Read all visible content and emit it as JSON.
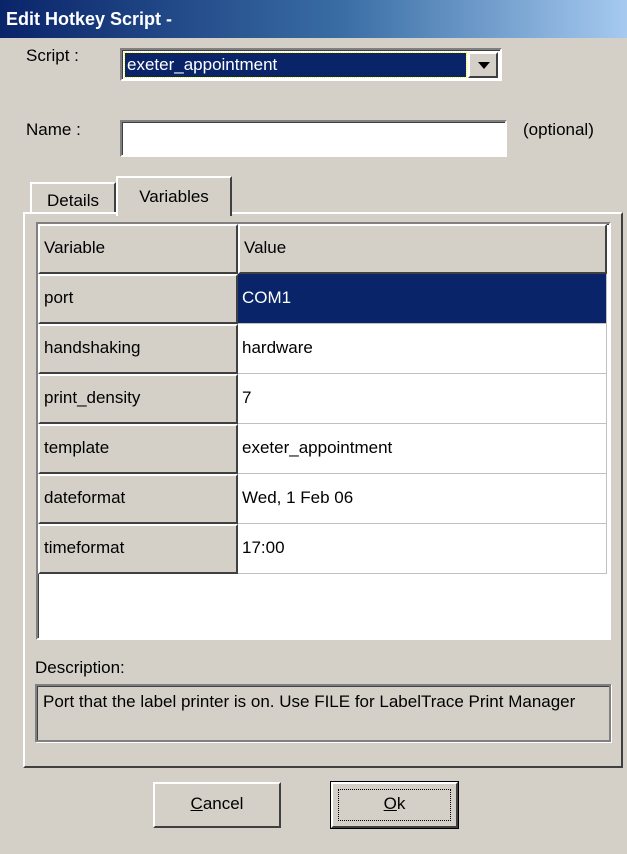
{
  "window": {
    "title": "Edit Hotkey Script -"
  },
  "form": {
    "script_label": "Script :",
    "script_value": "exeter_appointment",
    "name_label": "Name :",
    "name_value": "",
    "optional_label": "(optional)"
  },
  "tabs": [
    {
      "label": "Details",
      "active": false
    },
    {
      "label": "Variables",
      "active": true
    }
  ],
  "grid": {
    "headers": [
      "Variable",
      "Value"
    ],
    "rows": [
      {
        "name": "port",
        "value": "COM1",
        "selected": true
      },
      {
        "name": "handshaking",
        "value": "hardware"
      },
      {
        "name": "print_density",
        "value": "7"
      },
      {
        "name": "template",
        "value": "exeter_appointment"
      },
      {
        "name": "dateformat",
        "value": "Wed,  1 Feb 06"
      },
      {
        "name": "timeformat",
        "value": "17:00"
      }
    ]
  },
  "description": {
    "label": "Description:",
    "text": "Port that the label printer is on. Use FILE for LabelTrace Print Manager"
  },
  "buttons": {
    "cancel_first": "C",
    "cancel_rest": "ancel",
    "ok_first": "O",
    "ok_rest": "k"
  },
  "colors": {
    "face": "#d4d0c8",
    "selection": "#0a246a",
    "title_start": "#0a246a",
    "title_end": "#a6caf0"
  }
}
